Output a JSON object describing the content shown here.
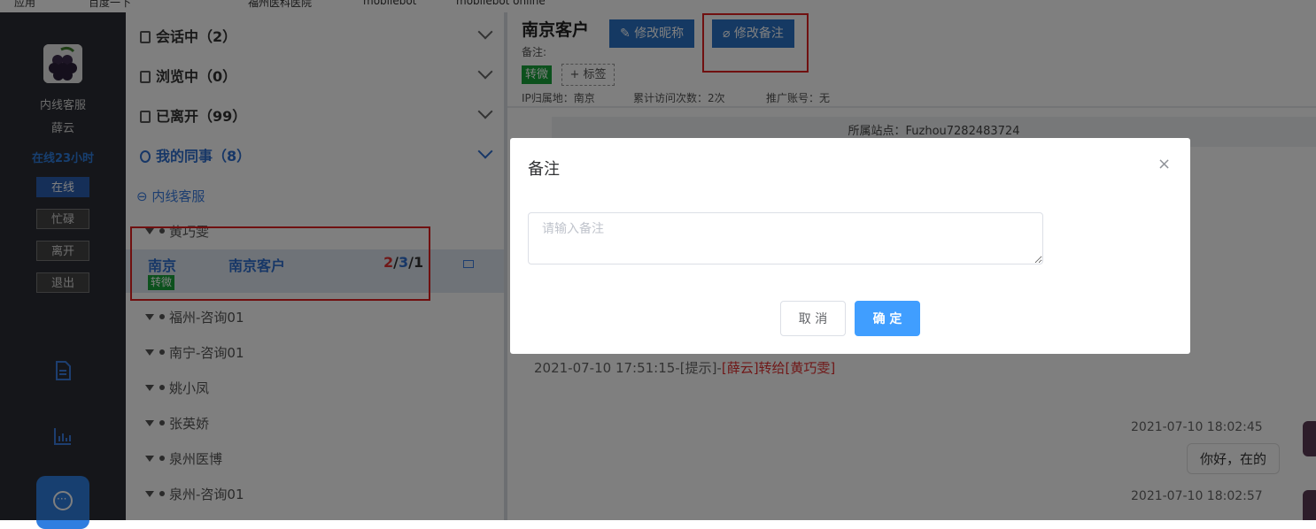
{
  "bookmarks": [
    "应用",
    "百度一下",
    "福州医科医院",
    "mobilebot",
    "mobilebot online"
  ],
  "sidebar": {
    "role": "内线客服",
    "name": "薛云",
    "online_time": "在线23小时",
    "status_buttons": [
      "在线",
      "忙碌",
      "离开",
      "退出"
    ],
    "active_status": "在线"
  },
  "list": {
    "sections": [
      {
        "label": "会话中（2）"
      },
      {
        "label": "浏览中（0）"
      },
      {
        "label": "已离开（99）"
      },
      {
        "label": "我的同事（8）"
      }
    ],
    "group": "内线客服",
    "agents": [
      "黄巧雯",
      "福州-咨询01",
      "南宁-咨询01",
      "姚小凤",
      "张英娇",
      "泉州医博",
      "泉州-咨询01"
    ],
    "customer": {
      "city": "南京",
      "name": "南京客户",
      "count_red": "2",
      "count_blue": "3",
      "count_black": "1",
      "tag": "转微"
    }
  },
  "main": {
    "title": "南京客户",
    "btn_nick": "修改昵称",
    "btn_note": "修改备注",
    "note_label": "备注:",
    "tag": "转微",
    "add_tag": "+ 标签",
    "ip": "IP归属地：南京",
    "visits": "累计访问次数：2次",
    "promo": "推广账号：无",
    "site": "所属站点：Fuzhou7282483724",
    "sys_time": "2021-07-10 17:51:15-[提示]-",
    "sys_hl": "[薛云]转给[黄巧雯]",
    "msg_time1": "2021-07-10 18:02:45",
    "msg1": "你好，在的",
    "msg_time2": "2021-07-10 18:02:57"
  },
  "dialog": {
    "title": "备注",
    "close": "×",
    "placeholder": "请输入备注",
    "cancel": "取 消",
    "confirm": "确 定"
  }
}
